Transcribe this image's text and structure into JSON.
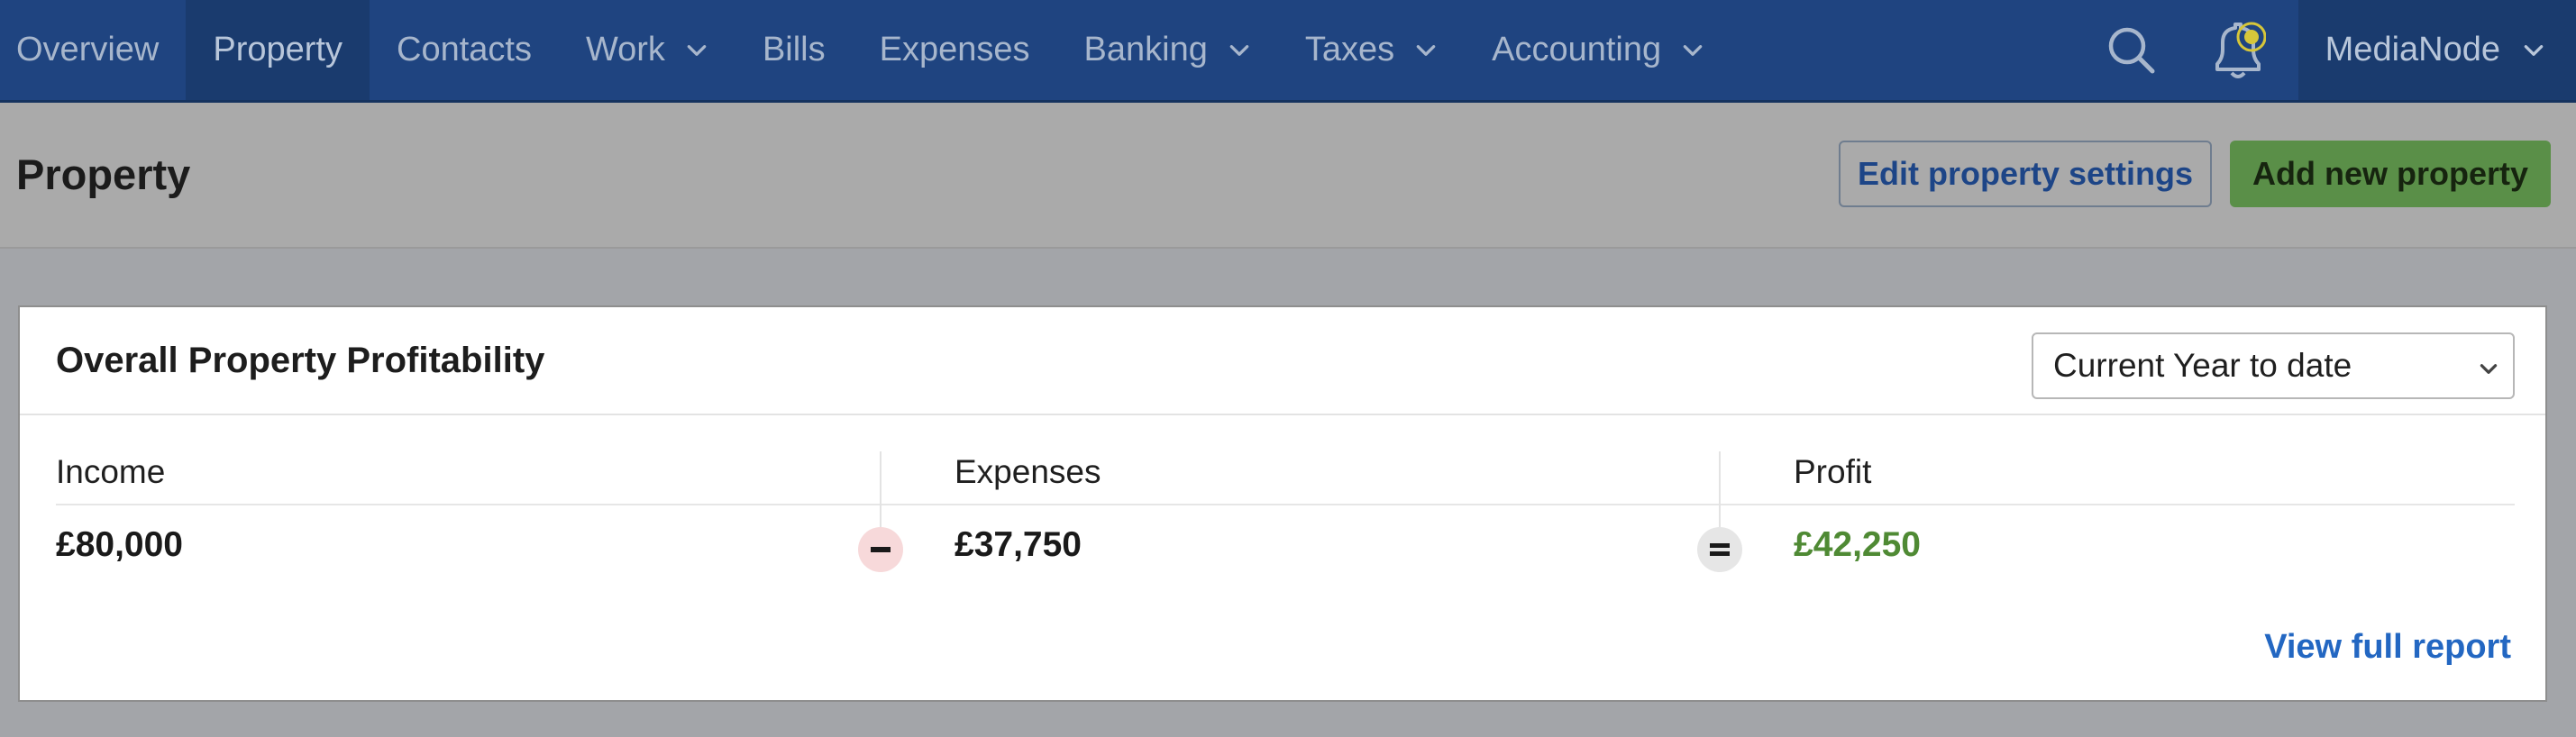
{
  "nav": {
    "items": [
      {
        "label": "Overview",
        "active": false,
        "dropdown": false
      },
      {
        "label": "Property",
        "active": true,
        "dropdown": false
      },
      {
        "label": "Contacts",
        "active": false,
        "dropdown": false
      },
      {
        "label": "Work",
        "active": false,
        "dropdown": true
      },
      {
        "label": "Bills",
        "active": false,
        "dropdown": false
      },
      {
        "label": "Expenses",
        "active": false,
        "dropdown": false
      },
      {
        "label": "Banking",
        "active": false,
        "dropdown": true
      },
      {
        "label": "Taxes",
        "active": false,
        "dropdown": true
      },
      {
        "label": "Accounting",
        "active": false,
        "dropdown": true
      }
    ],
    "search_icon": "search-icon",
    "notification_icon": "bell-icon",
    "account_name": "MediaNode"
  },
  "header": {
    "title": "Property",
    "edit_button": "Edit property settings",
    "add_button": "Add new property"
  },
  "card": {
    "title": "Overall Property Profitability",
    "period_select": "Current Year to date",
    "income_label": "Income",
    "income_value": "£80,000",
    "expenses_label": "Expenses",
    "expenses_value": "£37,750",
    "profit_label": "Profit",
    "profit_value": "£42,250",
    "view_report": "View full report"
  },
  "colors": {
    "nav_bg": "#1f4480",
    "primary_button": "#5a8f48",
    "link": "#2367c2",
    "profit": "#4f8a34"
  }
}
